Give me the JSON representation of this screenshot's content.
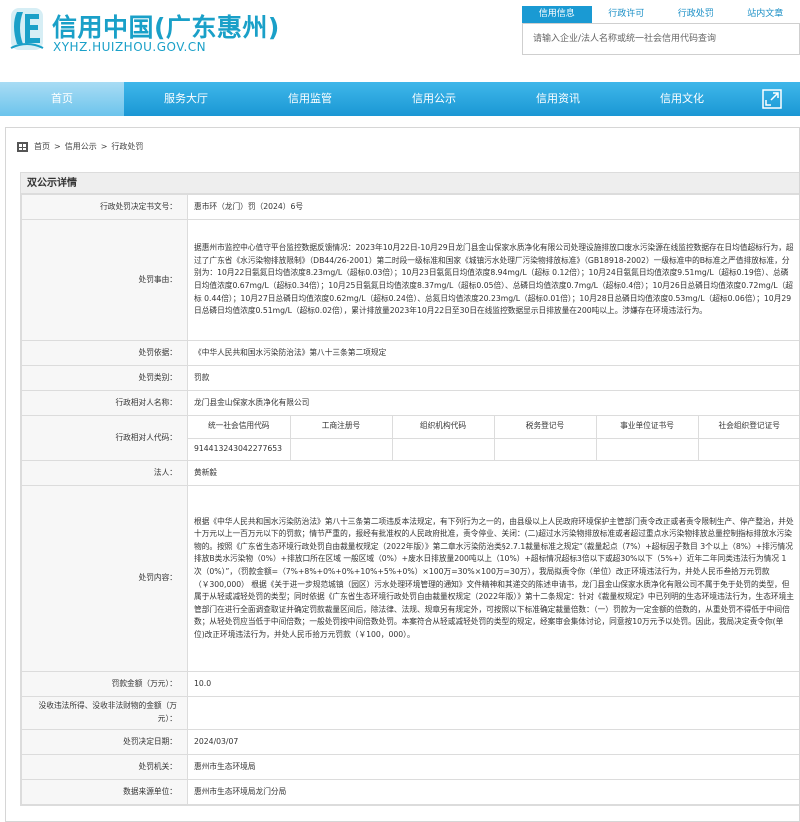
{
  "header": {
    "site_name": "信用中国(广东惠州)",
    "site_url": "XYHZ.HUIZHOU.GOV.CN",
    "brand_color": "#1aa0c8"
  },
  "search": {
    "tabs": [
      "信用信息",
      "行政许可",
      "行政处罚",
      "站内文章"
    ],
    "active_tab": "信用信息",
    "placeholder": "请输入企业/法人名称或统一社会信用代码查询"
  },
  "nav": {
    "items": [
      "首页",
      "服务大厅",
      "信用监管",
      "信用公示",
      "信用资讯",
      "信用文化"
    ],
    "active": "首页",
    "expand_icon": "expand-icon"
  },
  "breadcrumb": {
    "items": [
      "首页",
      "信用公示",
      "行政处罚"
    ],
    "separator": ">"
  },
  "detail": {
    "title": "双公示详情",
    "doc_number_label": "行政处罚决定书文号：",
    "doc_number": "惠市环（龙门）罚（2024）6号",
    "reason_label": "处罚事由：",
    "reason": "据惠州市监控中心值守平台监控数据反馈情况：2023年10月22日-10月29日龙门县金山保家水质净化有限公司处理设施排放口废水污染源在线监控数据存在日均值超标行为，超过了广东省《水污染物排放限制》（DB44/26-2001）第二时段一级标准和国家《城镇污水处理厂污染物排放标准》（GB18918-2002）一级标准中的B标准之严值排放标准，分别为：10月22日氨氮日均值浓度8.23mg/L（超标0.03倍）；10月23日氨氮日均值浓度8.94mg/L（超标 0.12倍）；10月24日氨氮日均值浓度9.51mg/L（超标0.19倍）、总磷日均值浓度0.67mg/L（超标0.34倍）；10月25日氨氮日均值浓度8.37mg/L（超标0.05倍）、总磷日均值浓度0.7mg/L（超标0.4倍）；10月26日总磷日均值浓度0.72mg/L（超标 0.44倍）；10月27日总磷日均值浓度0.62mg/L（超标0.24倍）、总氮日均值浓度20.23mg/L（超标0.01倍）；10月28日总磷日均值浓度0.53mg/L（超标0.06倍）；10月29日总磷日均值浓度0.51mg/L（超标0.02倍），累计排放量2023年10月22日至30日在线监控数据显示日排放量在200吨以上。涉嫌存在环境违法行为。",
    "basis_label": "处罚依据：",
    "basis": "《中华人民共和国水污染防治法》第八十三条第二项规定",
    "category_label": "处罚类别：",
    "category": "罚款",
    "counterparty_label": "行政相对人名称：",
    "counterparty": "龙门县金山保家水质净化有限公司",
    "code_label": "行政相对人代码：",
    "code_headers": [
      "统一社会信用代码",
      "工商注册号",
      "组织机构代码",
      "税务登记号",
      "事业单位证书号",
      "社会组织登记证号"
    ],
    "code_values": [
      "914413243042277653",
      "",
      "",
      "",
      "",
      ""
    ],
    "legal_rep_label": "法人：",
    "legal_rep": "黄新毅",
    "content_label": "处罚内容：",
    "content": "根据《中华人民共和国水污染防治法》第八十三条第二项违反本法规定，有下列行为之一的，由县级以上人民政府环境保护主管部门责令改正或者责令限制生产、停产整治，并处十万元以上一百万元以下的罚款；情节严重的，报经有批准权的人民政府批准，责令停业、关闭：(二)超过水污染物排放标准或者超过重点水污染物排放总量控制指标排放水污染物的。按照《广东省生态环境行政处罚自由裁量权规定（2022年版）》第二章水污染防治类§2.7.1裁量标准之规定“（裁量起点（7%）+超标因子数目 3个以上（8%）+排污情况排放B类水污染物（0%）+排放口所在区域 一般区域（0%）+废水日排放量200吨以上（10%）+超标情况超标3倍以下或超30%以下（5%+）近年二年同类违法行为情况 1次（0%）”，（罚款金额=（7%+8%+0%+0%+10%+5%+0%）×100万=30%×100万=30万），我局拟责令你（单位）改正环境违法行为，并处人民币叁拾万元罚款（￥300,000） 根据《关于进一步规范城镇（园区）污水处理环境管理的通知》文件精神和其递交的陈述申请书，龙门县金山保家水质净化有限公司不属于免于处罚的类型，但属于从轻或减轻处罚的类型；同时依据《广东省生态环境行政处罚自由裁量权规定（2022年版）》第十二条规定：针对《裁量权规定》中已列明的生态环境违法行为，生态环境主管部门在进行全面调查取证并确定罚款裁量区间后，除法律、法规、规章另有规定外，可按照以下标准确定裁量倍数：（一）罚款为一定金额的倍数的，从重处罚不得低于中间倍数；从轻处罚应当低于中间倍数；一般处罚按中间倍数处罚。本案符合从轻或减轻处罚的类型的规定，经案审会集体讨论，同意按10万元予以处罚。因此，我局决定责令你(单位)改正环境违法行为，并处人民币拾万元罚款（￥100，000）。",
    "amount_label": "罚款金额（万元）：",
    "amount": "10.0",
    "confiscation_label": "没收违法所得、没收非法财物的金额（万元）：",
    "confiscation": "",
    "date_label": "处罚决定日期：",
    "date": "2024/03/07",
    "authority_label": "处罚机关：",
    "authority": "惠州市生态环境局",
    "source_label": "数据来源单位：",
    "source": "惠州市生态环境局龙门分局"
  }
}
